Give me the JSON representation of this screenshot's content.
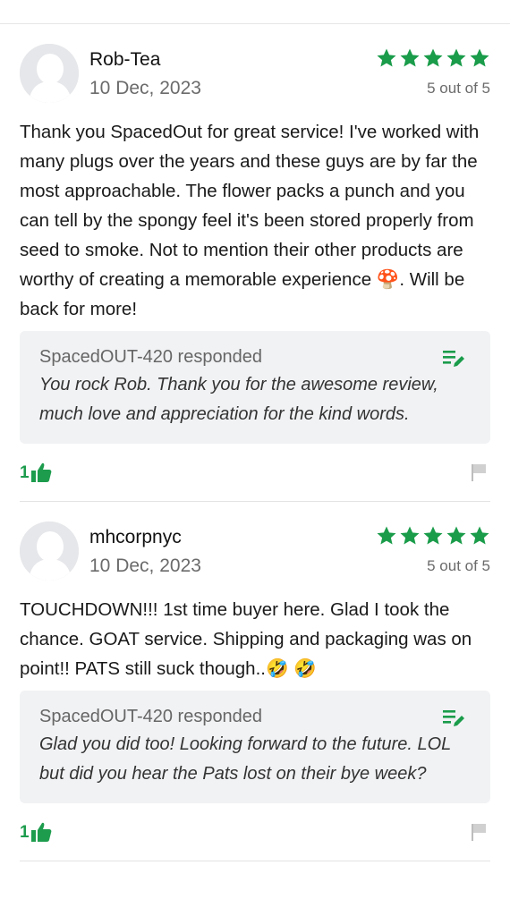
{
  "reviews": [
    {
      "author": "Rob-Tea",
      "date": "10 Dec, 2023",
      "rating": 5,
      "rating_text": "5 out of 5",
      "body": "Thank you SpacedOut for great service! I've worked with many plugs over the years and these guys are by far the most approachable. The flower packs a punch and you can tell by the spongy feel it's been stored properly from seed to smoke. Not to mention their other products are worthy of creating a memorable experience 🍄. Will be back for more!",
      "response": {
        "title": "SpacedOUT-420 responded",
        "text": "You rock Rob. Thank you for the awesome review, much love and appreciation for the kind words."
      },
      "likes": "1"
    },
    {
      "author": "mhcorpnyc",
      "date": "10 Dec, 2023",
      "rating": 5,
      "rating_text": "5 out of 5",
      "body": "TOUCHDOWN!!! 1st time buyer here. Glad I took the chance. GOAT service. Shipping and packaging was on point!! PATS still suck though..🤣 🤣",
      "response": {
        "title": "SpacedOUT-420 responded",
        "text": "Glad you did too! Looking forward to the future. LOL but did you hear the Pats lost on their bye week?"
      },
      "likes": "1"
    }
  ],
  "colors": {
    "star": "#1a9c4a",
    "like": "#1d9c4d",
    "response_bg": "#f1f2f4"
  },
  "icons": [
    "avatar-placeholder-icon",
    "star-icon",
    "respond-edit-icon",
    "thumbs-up-icon",
    "flag-icon"
  ]
}
